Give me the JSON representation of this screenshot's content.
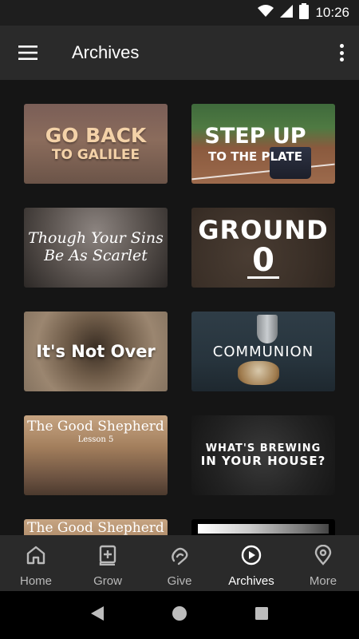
{
  "status_bar": {
    "time": "10:26"
  },
  "app_bar": {
    "title": "Archives"
  },
  "cards": [
    {
      "line1": "GO BACK",
      "line2": "TO GALILEE"
    },
    {
      "line1": "STEP UP",
      "line2": "TO THE PLATE"
    },
    {
      "line1": "Though Your Sins",
      "line2": "Be As Scarlet"
    },
    {
      "line1": "GROUND",
      "line2": "0"
    },
    {
      "line1": "It's Not Over"
    },
    {
      "line1": "COMMUNION"
    },
    {
      "line1": "The Good Shepherd",
      "line2": "Lesson 5"
    },
    {
      "line1": "WHAT'S BREWING",
      "line2": "IN YOUR HOUSE?"
    },
    {
      "line1": "The Good Shepherd"
    },
    {
      "line1": ""
    }
  ],
  "bottom_nav": [
    {
      "label": "Home",
      "icon": "home-icon"
    },
    {
      "label": "Grow",
      "icon": "book-plus-icon"
    },
    {
      "label": "Give",
      "icon": "give-icon"
    },
    {
      "label": "Archives",
      "icon": "play-circle-icon",
      "active": true
    },
    {
      "label": "More",
      "icon": "location-pin-icon"
    }
  ]
}
